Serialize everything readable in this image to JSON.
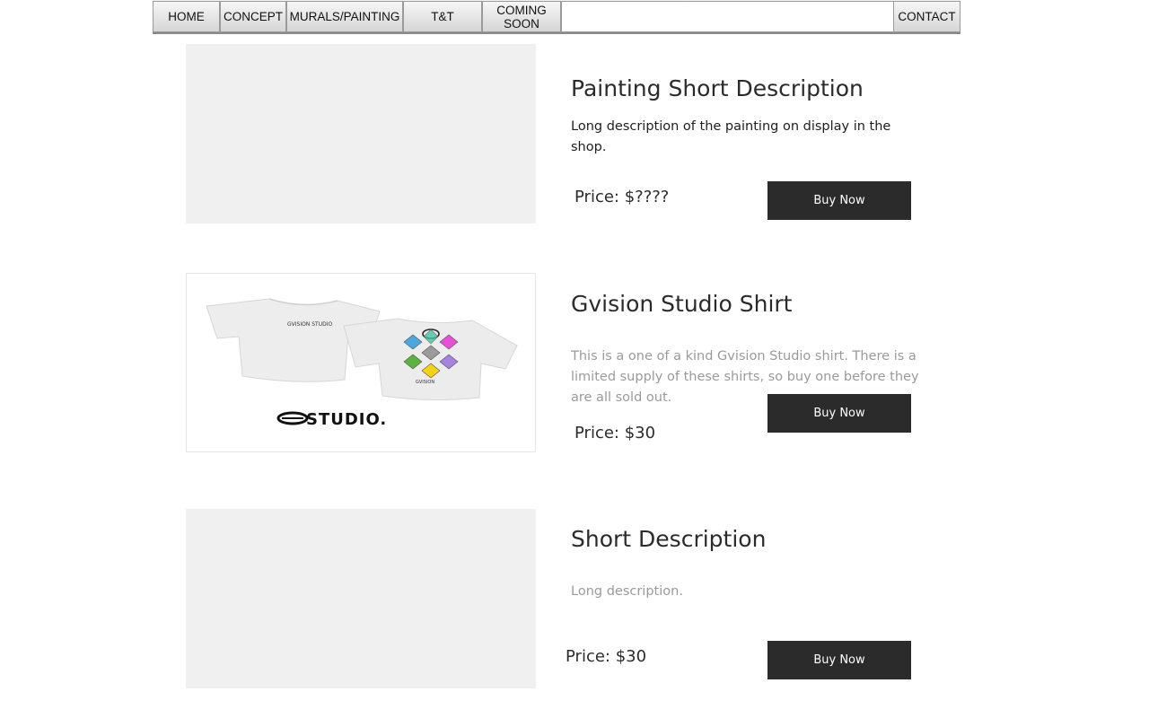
{
  "nav": {
    "items": [
      {
        "label": "HOME"
      },
      {
        "label": "CONCEPT"
      },
      {
        "label": "MURALS/PAINTING"
      },
      {
        "label": "T&T"
      },
      {
        "label": "COMING\nSOON"
      },
      {
        "label": "CONTACT"
      }
    ]
  },
  "products": [
    {
      "title": "Painting Short Description",
      "description": "Long description of the painting on display in the shop.",
      "price": "Price: $????",
      "button": "Buy Now"
    },
    {
      "title": "Gvision Studio Shirt",
      "description": "This is a one of a kind Gvision Studio shirt. There is a limited supply of these shirts, so buy one before they are all sold out.",
      "price": "Price: $30",
      "button": "Buy Now",
      "image_text": {
        "front_print": "GVISION STUDIO",
        "back_print": "GVISION",
        "logo": "STUDIO."
      }
    },
    {
      "title": "Short Description",
      "description": "Long description.",
      "price": "Price: $30",
      "button": "Buy Now"
    }
  ]
}
